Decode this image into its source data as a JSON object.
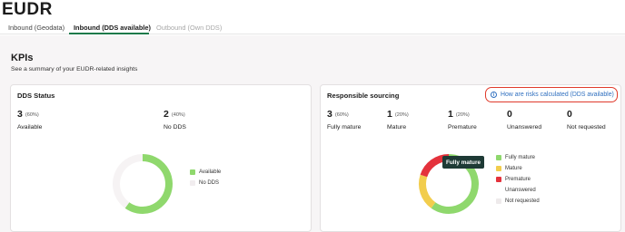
{
  "header": {
    "title": "EUDR"
  },
  "tabs": [
    {
      "label": "Inbound (Geodata)"
    },
    {
      "label": "Inbound (DDS available)"
    },
    {
      "label": "Outbound (Own DDS)"
    }
  ],
  "kpis": {
    "heading": "KPIs",
    "subtitle": "See a summary of your EUDR-related insights"
  },
  "dds_status": {
    "title": "DDS Status",
    "metrics": [
      {
        "value": "3",
        "pct": "(60%)",
        "label": "Available"
      },
      {
        "value": "2",
        "pct": "(40%)",
        "label": "No DDS"
      }
    ],
    "legend": [
      {
        "label": "Available",
        "color": "#8fd86d"
      },
      {
        "label": "No DDS",
        "color": "#f1edef"
      }
    ]
  },
  "responsible_sourcing": {
    "title": "Responsible sourcing",
    "link_text": "How are risks calculated (DDS available)",
    "metrics": [
      {
        "value": "3",
        "pct": "(60%)",
        "label": "Fully mature"
      },
      {
        "value": "1",
        "pct": "(20%)",
        "label": "Mature"
      },
      {
        "value": "1",
        "pct": "(20%)",
        "label": "Premature"
      },
      {
        "value": "0",
        "pct": "",
        "label": "Unanswered"
      },
      {
        "value": "0",
        "pct": "",
        "label": "Not requested"
      }
    ],
    "legend": [
      {
        "label": "Fully mature",
        "color": "#8fd86d"
      },
      {
        "label": "Mature",
        "color": "#f2cd4d"
      },
      {
        "label": "Premature",
        "color": "#e4323c"
      },
      {
        "label": "Unanswered",
        "color": "#ffffff"
      },
      {
        "label": "Not requested",
        "color": "#eeeaeb"
      }
    ],
    "tooltip": "Fully mature"
  },
  "chart_data": [
    {
      "type": "pie",
      "categories": [
        "Available",
        "No DDS"
      ],
      "values": [
        3,
        2
      ],
      "colors": [
        "#8fd86d",
        "#f6f3f4"
      ]
    },
    {
      "type": "pie",
      "categories": [
        "Fully mature",
        "Mature",
        "Premature",
        "Unanswered",
        "Not requested"
      ],
      "values": [
        3,
        1,
        1,
        0,
        0
      ],
      "colors": [
        "#8fd86d",
        "#f2cd4d",
        "#e4323c",
        "#ffffff",
        "#eeeaeb"
      ]
    }
  ]
}
